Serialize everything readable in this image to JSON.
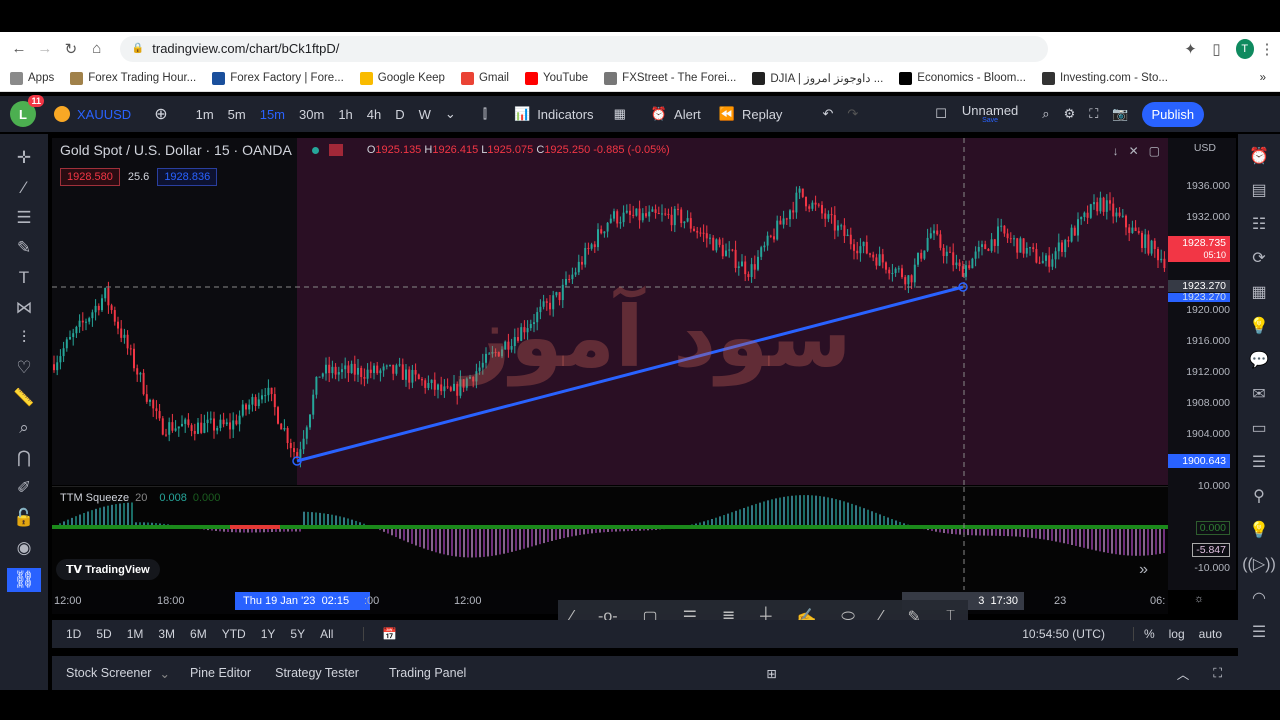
{
  "browser": {
    "url": "tradingview.com/chart/bCk1ftpD/",
    "profile_initial": "T",
    "bookmarks": [
      "Apps",
      "Forex Trading Hour...",
      "Forex Factory | Fore...",
      "Google Keep",
      "Gmail",
      "YouTube",
      "FXStreet - The Forei...",
      "DJIA | داوجونز امروز ...",
      "Economics - Bloom...",
      "Investing.com - Sto..."
    ]
  },
  "toolbar": {
    "avatar": "L",
    "notif": "11",
    "symbol": "XAUUSD",
    "intervals": [
      "1m",
      "5m",
      "15m",
      "30m",
      "1h",
      "4h",
      "D",
      "W"
    ],
    "active_interval": "15m",
    "indicators": "Indicators",
    "alert": "Alert",
    "replay": "Replay",
    "layout_name": "Unnamed",
    "layout_sub": "Save",
    "publish": "Publish"
  },
  "chart": {
    "title": "Gold Spot / U.S. Dollar · 15 · OANDA",
    "ohlc": {
      "o_label": "O",
      "o": "1925.135",
      "h_label": "H",
      "h": "1926.415",
      "l_label": "L",
      "l": "1925.075",
      "c_label": "C",
      "c": "1925.250",
      "chg": "-0.885 (-0.05%)"
    },
    "sell": "1928.580",
    "spread": "25.6",
    "buy": "1928.836",
    "currency": "USD",
    "watermark": "سود آموز",
    "price_ticks": [
      "1936.000",
      "1932.000",
      "1920.000",
      "1916.000",
      "1912.000",
      "1908.000",
      "1904.000"
    ],
    "last_price": "1928.735",
    "countdown": "05:10",
    "crosshair_price": "1923.270",
    "line_price": "1923.270",
    "low_label": "1900.643",
    "colors": {
      "up": "#26a69a",
      "down": "#f23645",
      "trendline": "#2962ff",
      "accent": "#2962ff"
    }
  },
  "indicator": {
    "name": "TTM Squeeze",
    "length": "20",
    "v1": "0.008",
    "v2": "0.000",
    "scale_top": "10.000",
    "scale_zero": "0.000",
    "current": "-5.847",
    "scale_bottom": "-10.000",
    "brand": "TradingView"
  },
  "time_axis": {
    "ticks": [
      "12:00",
      "18:00",
      ":00",
      "12:00",
      "23",
      "06:"
    ],
    "crosshair_date": "Thu 19 Jan '23",
    "crosshair_time": "02:15",
    "right_cross": "17:30",
    "right_cross_prefix": "3"
  },
  "range": {
    "items": [
      "1D",
      "5D",
      "1M",
      "3M",
      "6M",
      "YTD",
      "1Y",
      "5Y",
      "All"
    ],
    "clock": "10:54:50 (UTC)",
    "pct": "%",
    "log": "log",
    "auto": "auto"
  },
  "bottom_tabs": [
    "Stock Screener",
    "Pine Editor",
    "Strategy Tester",
    "Trading Panel"
  ]
}
